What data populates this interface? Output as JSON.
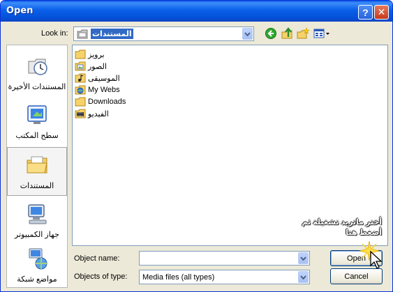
{
  "window": {
    "title": "Open",
    "help_glyph": "?",
    "close_glyph": "✕"
  },
  "toolbar": {
    "look_in_label": "Look in:",
    "look_in_value": "المستندات",
    "icons": [
      "back-icon",
      "up-folder-icon",
      "new-folder-icon",
      "view-menu-icon"
    ]
  },
  "places": [
    {
      "label": "المستندات الأخيرة",
      "icon": "recent-documents-icon"
    },
    {
      "label": "سطح المكتب",
      "icon": "desktop-icon"
    },
    {
      "label": "المستندات",
      "icon": "my-documents-icon"
    },
    {
      "label": "جهاز الكمبيوتر",
      "icon": "my-computer-icon"
    },
    {
      "label": "مواضع شبكة",
      "icon": "network-places-icon"
    }
  ],
  "files": [
    {
      "name": "برويز",
      "icon": "folder-icon"
    },
    {
      "name": "الصور",
      "icon": "pictures-folder-icon"
    },
    {
      "name": "الموسيقى",
      "icon": "music-folder-icon"
    },
    {
      "name": "My Webs",
      "icon": "webs-folder-icon"
    },
    {
      "name": "Downloads",
      "icon": "folder-icon"
    },
    {
      "name": "الفيديو",
      "icon": "video-folder-icon"
    }
  ],
  "form": {
    "object_name_label": "Object name:",
    "object_name_value": "",
    "object_type_label": "Objects of type:",
    "object_type_value": "Media files (all types)"
  },
  "buttons": {
    "open": "Open",
    "cancel": "Cancel"
  },
  "annotation": {
    "line1": "أختر ماتريد تشغيلة ثم",
    "line2": "أضغط هنا"
  },
  "colors": {
    "titlebar": "#0a5fe8",
    "selection": "#316ac5",
    "dialog_bg": "#ece9d8"
  }
}
